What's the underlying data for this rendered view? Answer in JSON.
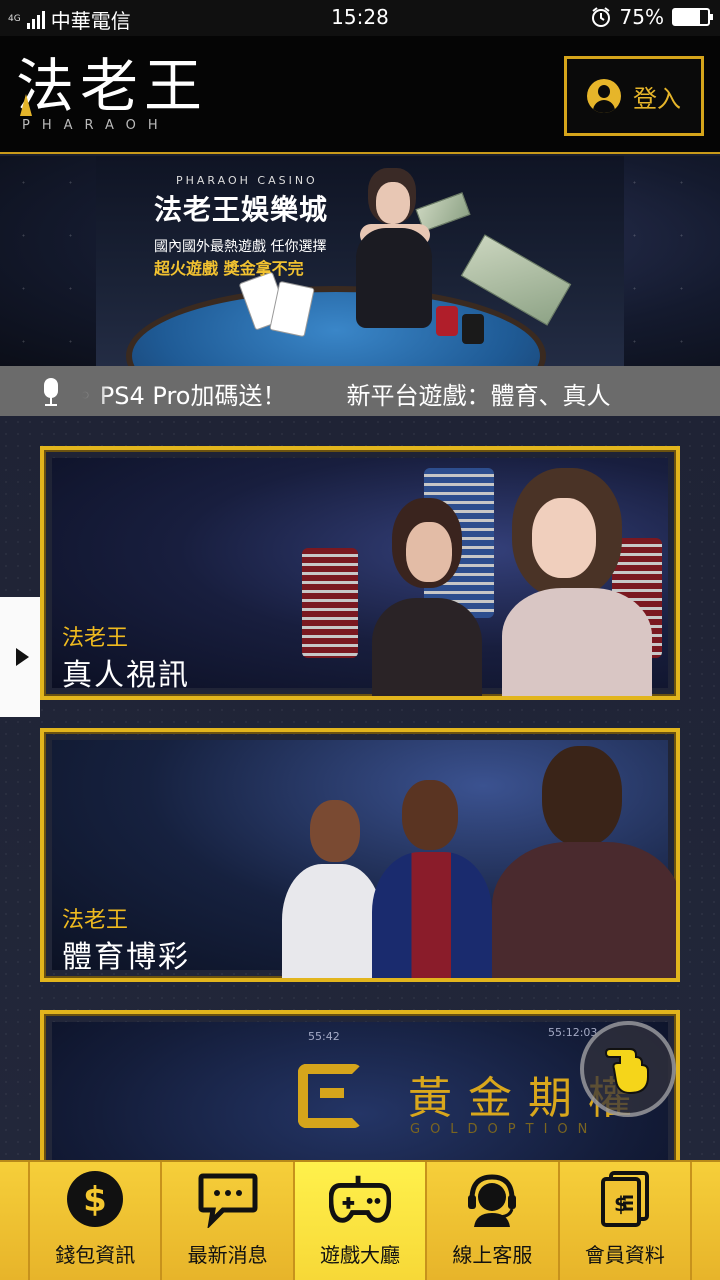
{
  "status_bar": {
    "network": "4G",
    "carrier": "中華電信",
    "time": "15:28",
    "battery": "75%",
    "battery_level": 0.75,
    "icons": [
      "signal-icon",
      "alarm-icon",
      "battery-icon"
    ]
  },
  "header": {
    "logo_cn": "法老王",
    "logo_en": "PHARAOH",
    "login_label": "登入",
    "accent": "#e6b52a"
  },
  "banner": {
    "subtitle": "PHARAOH CASINO",
    "title": "法老王娛樂城",
    "line1": "國內國外最熱遊戲 任你選擇",
    "line2": "超火遊戲 獎金拿不完"
  },
  "ticker": {
    "items": [
      "PS4 Pro加碼送！",
      "新平台遊戲：體育、真人"
    ]
  },
  "games": [
    {
      "brand": "法老王",
      "title": "真人視訊"
    },
    {
      "brand": "法老王",
      "title": "體育博彩"
    },
    {
      "title_cn": "黃金期權",
      "title_en": "GOLDOPTION",
      "numbers": [
        "55:42",
        "55:12:03"
      ]
    }
  ],
  "bottom_nav": [
    {
      "label": "錢包資訊",
      "icon": "wallet-dollar-icon",
      "active": false
    },
    {
      "label": "最新消息",
      "icon": "chat-bubble-icon",
      "active": false
    },
    {
      "label": "遊戲大廳",
      "icon": "gamepad-icon",
      "active": true
    },
    {
      "label": "線上客服",
      "icon": "headset-icon",
      "active": false
    },
    {
      "label": "會員資料",
      "icon": "document-dollar-icon",
      "active": false
    }
  ],
  "colors": {
    "gold": "#e2b51d",
    "nav_bg": "#f0c232",
    "nav_active": "#fff14c",
    "page_bg": "#1c2030"
  }
}
